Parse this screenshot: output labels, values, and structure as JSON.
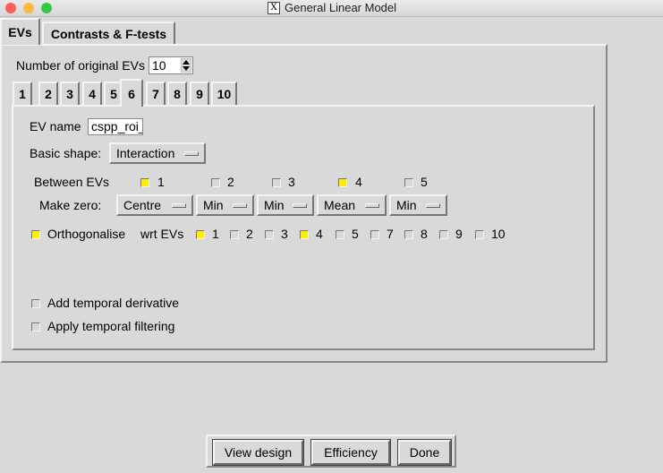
{
  "window": {
    "title": "General Linear Model",
    "traffic_colors": [
      "#fc605c",
      "#fdbc40",
      "#34c84a"
    ]
  },
  "main_tabs": [
    {
      "label": "EVs",
      "active": true
    },
    {
      "label": "Contrasts & F-tests",
      "active": false
    }
  ],
  "num_evs": {
    "label": "Number of original EVs",
    "value": "10"
  },
  "ev_tabs": [
    "1",
    "2",
    "3",
    "4",
    "5",
    "6",
    "7",
    "8",
    "9",
    "10"
  ],
  "active_ev_tab": "6",
  "ev_name": {
    "label": "EV name",
    "value": "cspp_roi_"
  },
  "basic_shape": {
    "label": "Basic shape:",
    "value": "Interaction"
  },
  "between": {
    "label": "Between EVs",
    "items": [
      {
        "label": "1",
        "checked": true
      },
      {
        "label": "2",
        "checked": false
      },
      {
        "label": "3",
        "checked": false
      },
      {
        "label": "4",
        "checked": true
      },
      {
        "label": "5",
        "checked": false
      }
    ]
  },
  "make_zero": {
    "label": "Make zero:",
    "values": [
      "Centre",
      "Min",
      "Min",
      "Mean",
      "Min"
    ]
  },
  "orthogonalise": {
    "label": "Orthogonalise",
    "checked": true,
    "wrt_label": "wrt EVs",
    "items": [
      {
        "label": "1",
        "checked": true
      },
      {
        "label": "2",
        "checked": false
      },
      {
        "label": "3",
        "checked": false
      },
      {
        "label": "4",
        "checked": true
      },
      {
        "label": "5",
        "checked": false
      },
      {
        "label": "7",
        "checked": false
      },
      {
        "label": "8",
        "checked": false
      },
      {
        "label": "9",
        "checked": false
      },
      {
        "label": "10",
        "checked": false
      }
    ]
  },
  "temporal_derivative": {
    "label": "Add temporal derivative",
    "checked": false
  },
  "temporal_filtering": {
    "label": "Apply temporal filtering",
    "checked": false
  },
  "buttons": {
    "view_design": "View design",
    "efficiency": "Efficiency",
    "done": "Done"
  },
  "colors": {
    "background": "#d9d9d9",
    "checked": "#ffee00"
  }
}
